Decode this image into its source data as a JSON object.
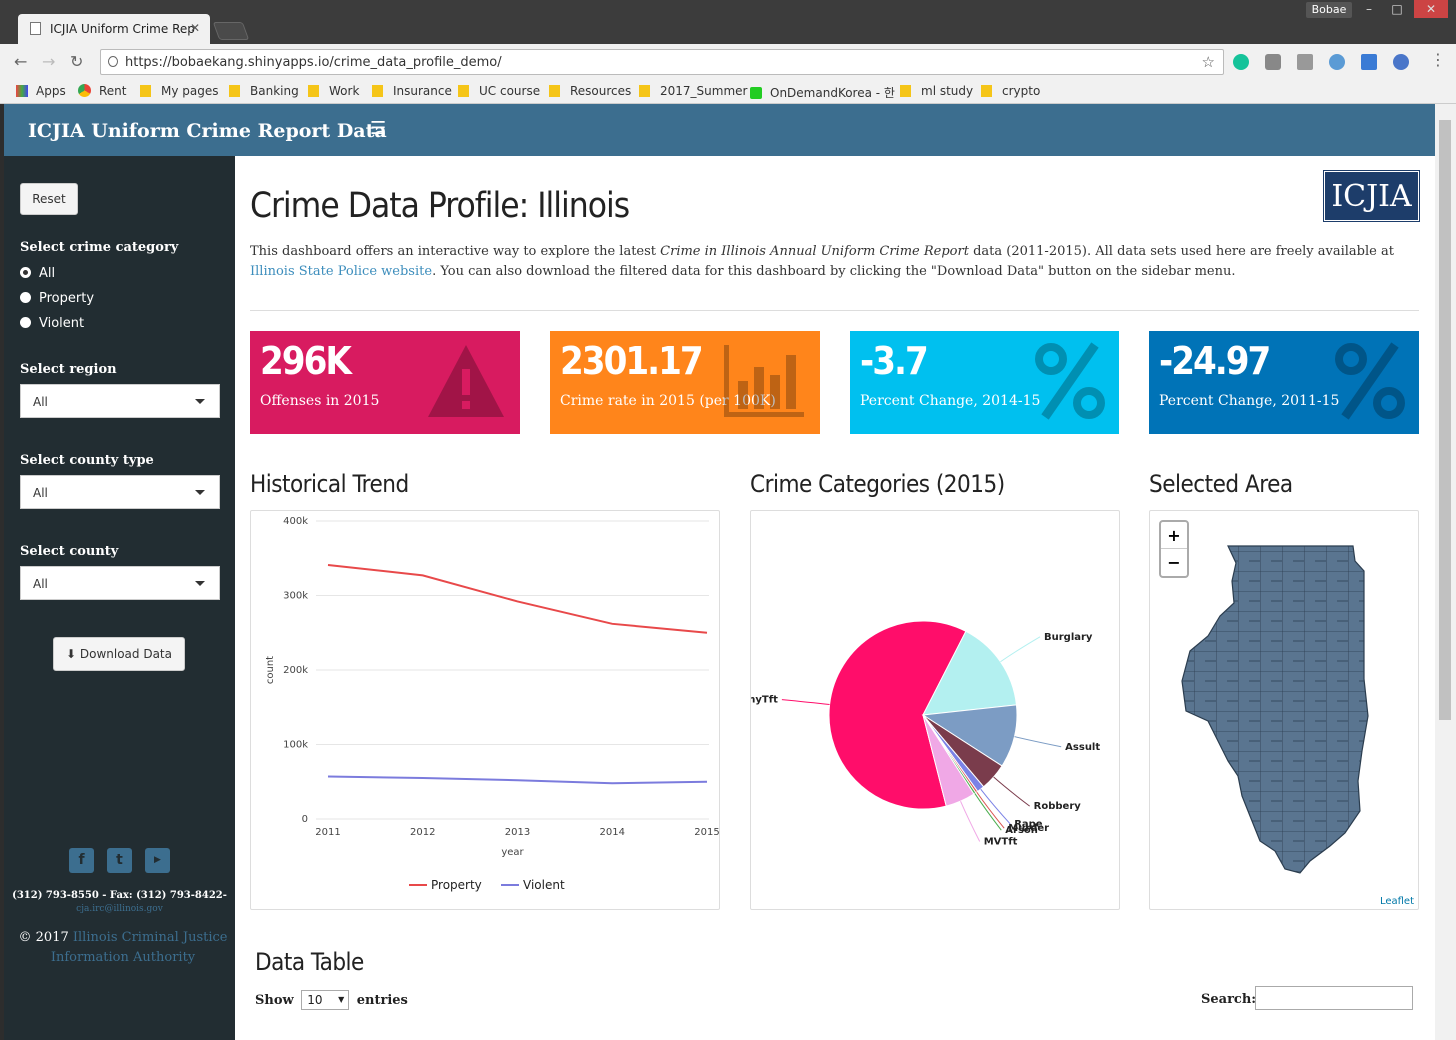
{
  "browser": {
    "tab_title": "ICJIA Uniform Crime Rep",
    "url": "https://bobaekang.shinyapps.io/crime_data_profile_demo/",
    "profile": "Bobae",
    "bookmarks": [
      "Apps",
      "Rent",
      "My pages",
      "Banking",
      "Work",
      "Insurance",
      "UC course",
      "Resources",
      "2017_Summer",
      "OnDemandKorea - 한",
      "ml study",
      "crypto"
    ]
  },
  "header": {
    "title": "ICJIA Uniform Crime Report Data",
    "menu_icon": "hamburger-icon"
  },
  "sidebar": {
    "reset_label": "Reset",
    "category_label": "Select crime category",
    "category_options": [
      "All",
      "Property",
      "Violent"
    ],
    "category_selected": "All",
    "region_label": "Select region",
    "region_value": "All",
    "county_type_label": "Select county type",
    "county_type_value": "All",
    "county_label": "Select county",
    "county_value": "All",
    "download_label": "Download Data",
    "phone": "(312) 793-8550 - Fax: (312) 793-8422-",
    "email": "cja.irc@illinois.gov",
    "copyright": "© 2017",
    "org_line1": "Illinois Criminal Justice",
    "org_line2": "Information Authority"
  },
  "main": {
    "title": "Crime Data Profile: Illinois",
    "logo_text": "ICJIA",
    "intro_1": "This dashboard offers an interactive way to explore the latest ",
    "intro_em": "Crime in Illinois Annual Uniform Crime Report",
    "intro_2": " data (2011-2015). All data sets used here are freely available at ",
    "intro_link": "Illinois State Police website",
    "intro_3": ". You can also download the filtered data for this dashboard by clicking the \"Download Data\" button on the sidebar menu."
  },
  "value_boxes": [
    {
      "value": "296K",
      "label": "Offenses in 2015",
      "color": "#d81b60",
      "icon": "warning-icon"
    },
    {
      "value": "2301.17",
      "label": "Crime rate in 2015 (per 100K)",
      "color": "#ff851b",
      "icon": "bar-chart-icon"
    },
    {
      "value": "-3.7",
      "label": "Percent Change, 2014-15",
      "color": "#00c0ef",
      "icon": "percent-icon"
    },
    {
      "value": "-24.97",
      "label": "Percent Change, 2011-15",
      "color": "#0073b7",
      "icon": "percent-icon"
    }
  ],
  "sections": {
    "trend_title": "Historical Trend",
    "pie_title": "Crime Categories (2015)",
    "map_title": "Selected Area",
    "table_title": "Data Table"
  },
  "chart_data": [
    {
      "type": "line",
      "x": [
        2011,
        2012,
        2013,
        2014,
        2015
      ],
      "xlabel": "year",
      "ylabel": "count",
      "ylim": [
        0,
        400000
      ],
      "yticks": [
        "0",
        "100k",
        "200k",
        "300k",
        "400k"
      ],
      "series": [
        {
          "name": "Property",
          "color": "#e8494a",
          "values": [
            341000,
            327000,
            292000,
            262000,
            250000
          ]
        },
        {
          "name": "Violent",
          "color": "#7b7bdd",
          "values": [
            57000,
            55000,
            52000,
            48000,
            50000
          ]
        }
      ],
      "legend": "bottom"
    },
    {
      "type": "pie",
      "labels": [
        "LarcenyTft",
        "Burglary",
        "Assult",
        "Robbery",
        "Rape",
        "Murder",
        "Arson",
        "MVTft"
      ],
      "values": [
        62.5,
        16.0,
        11.0,
        4.8,
        1.3,
        0.4,
        0.4,
        5.2
      ],
      "colors": [
        "#ff0d6a",
        "#b3f0f0",
        "#7c9cc4",
        "#7a3c4c",
        "#7b82e6",
        "#d9534f",
        "#4caf50",
        "#f0a8e6"
      ]
    }
  ],
  "map": {
    "zoom_in": "+",
    "zoom_out": "−",
    "attribution": "Leaflet"
  },
  "table": {
    "show_label": "Show",
    "entries_value": "10",
    "entries_label": "entries",
    "search_label": "Search:"
  }
}
